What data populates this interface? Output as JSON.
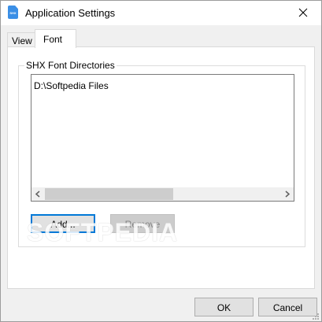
{
  "window": {
    "title": "Application Settings",
    "icon": "app-file-icon",
    "icon_text": "SHX",
    "close_icon": "close-icon"
  },
  "tabs": [
    {
      "label": "View",
      "selected": false
    },
    {
      "label": "Font",
      "selected": true
    }
  ],
  "group": {
    "label": "SHX Font Directories",
    "items": [
      "D:\\Softpedia Files"
    ]
  },
  "buttons": {
    "add_label": "Add...",
    "remove_label": "Remove",
    "ok_label": "OK",
    "cancel_label": "Cancel"
  },
  "watermark": "SOFTPEDIA",
  "colors": {
    "accent": "#0078d7",
    "icon_blue": "#3b8fe6"
  }
}
